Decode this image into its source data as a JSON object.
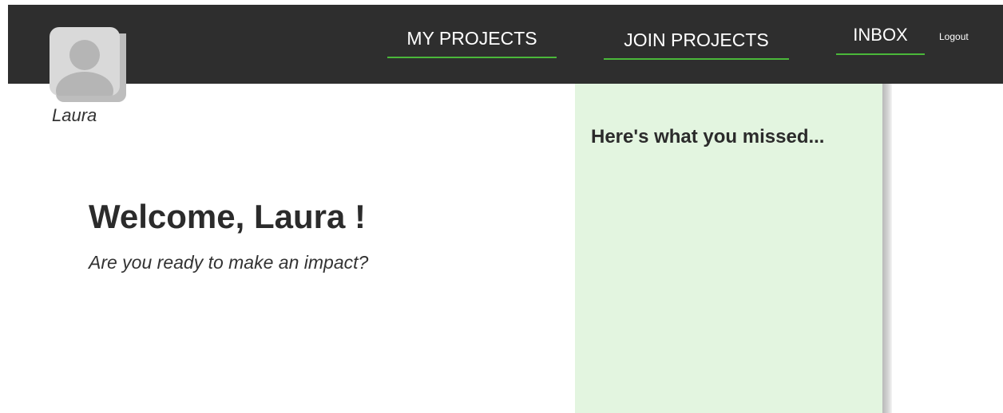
{
  "nav": {
    "my_projects": "MY PROJECTS",
    "join_projects": "JOIN PROJECTS",
    "inbox": "INBOX",
    "logout": "Logout"
  },
  "user": {
    "name": "Laura",
    "avatar_icon": "user-silhouette-icon"
  },
  "main": {
    "welcome": "Welcome, Laura !",
    "subtitle": "Are you ready to make an impact?"
  },
  "missed": {
    "title": "Here's what you missed..."
  },
  "colors": {
    "navbar": "#2e2e2e",
    "accent": "#4ab83a",
    "panel": "#e3f5e0"
  }
}
